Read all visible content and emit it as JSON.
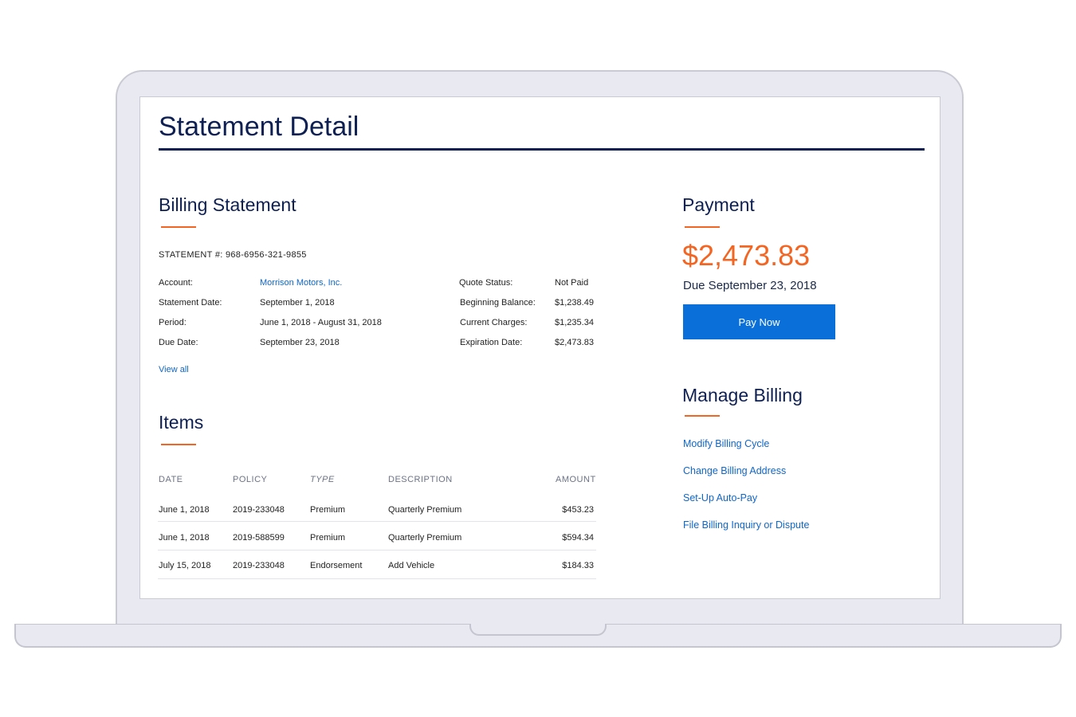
{
  "page": {
    "title": "Statement Detail"
  },
  "billing": {
    "heading": "Billing Statement",
    "statement_number": "STATEMENT #: 968-6956-321-9855",
    "left": [
      {
        "label": "Account:",
        "value": "Morrison Motors, Inc."
      },
      {
        "label": "Statement Date:",
        "value": "September 1, 2018"
      },
      {
        "label": "Period:",
        "value": "June 1, 2018 - August 31, 2018"
      },
      {
        "label": "Due Date:",
        "value": "September 23, 2018"
      }
    ],
    "right": [
      {
        "label": "Quote Status:",
        "value": "Not Paid"
      },
      {
        "label": "Beginning Balance:",
        "value": "$1,238.49"
      },
      {
        "label": "Current Charges:",
        "value": "$1,235.34"
      },
      {
        "label": "Expiration Date:",
        "value": "$2,473.83"
      }
    ],
    "view_all": "View all"
  },
  "items": {
    "heading": "Items",
    "columns": [
      "DATE",
      "POLICY",
      "TYPE",
      "DESCRIPTION",
      "AMOUNT"
    ],
    "rows": [
      [
        "June 1, 2018",
        "2019-233048",
        "Premium",
        "Quarterly Premium",
        "$453.23"
      ],
      [
        "June 1, 2018",
        "2019-588599",
        "Premium",
        "Quarterly Premium",
        "$594.34"
      ],
      [
        "July 15, 2018",
        "2019-233048",
        "Endorsement",
        "Add Vehicle",
        "$184.33"
      ]
    ]
  },
  "payment": {
    "heading": "Payment",
    "amount": "$2,473.83",
    "due": "Due September 23, 2018",
    "button": "Pay Now"
  },
  "manage": {
    "heading": "Manage Billing",
    "links": [
      "Modify Billing Cycle",
      "Change Billing Address",
      "Set-Up Auto-Pay",
      "File Billing Inquiry or Dispute"
    ]
  },
  "colors": {
    "navy": "#0e1f52",
    "accent": "#f26522",
    "link": "#1066c8",
    "button": "#0a6fd8"
  }
}
